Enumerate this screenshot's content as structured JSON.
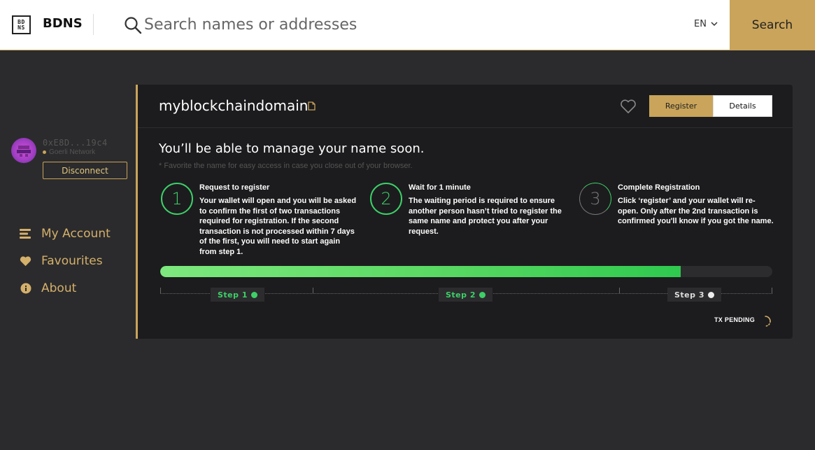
{
  "header": {
    "logo_text_top": "BD",
    "logo_text_bottom": "NS",
    "brand": "BDNS",
    "search_placeholder": "Search names or addresses",
    "language": "EN",
    "search_button": "Search",
    "accent_color": "#c9a45a"
  },
  "account": {
    "address": "0xE8D...19c4",
    "network": "Goerli Network",
    "disconnect_label": "Disconnect"
  },
  "sidebar": {
    "items": [
      {
        "label": "My Account",
        "icon": "list-icon"
      },
      {
        "label": "Favourites",
        "icon": "heart-icon"
      },
      {
        "label": "About",
        "icon": "info-icon"
      }
    ]
  },
  "card": {
    "domain": "myblockchaindomain",
    "tabs": [
      {
        "label": "Register",
        "active": true
      },
      {
        "label": "Details",
        "active": false
      }
    ],
    "headline": "You’ll be able to manage your name soon.",
    "hint": "* Favorite the name for easy access in case you close out of your browser.",
    "steps": [
      {
        "number": "1",
        "title": "Request to register",
        "body": "Your wallet will open and you will be asked to confirm the first of two transactions required for registration. If the second transaction is not processed within 7 days of the first, you will need to start again from step 1.",
        "status": "done"
      },
      {
        "number": "2",
        "title": "Wait for 1 minute",
        "body": "The waiting period is required to ensure another person hasn’t tried to register the same name and protect you after your request.",
        "status": "done"
      },
      {
        "number": "3",
        "title": "Complete Registration",
        "body": "Click ‘register’ and your wallet will re-open. Only after the 2nd transaction is confirmed you'll know if you got the name.",
        "status": "pending"
      }
    ],
    "progress_fraction": 0.85,
    "timeline_labels": [
      "Step 1",
      "Step 2",
      "Step 3"
    ],
    "tx_status": "TX PENDING",
    "success_color": "#3dd068"
  }
}
